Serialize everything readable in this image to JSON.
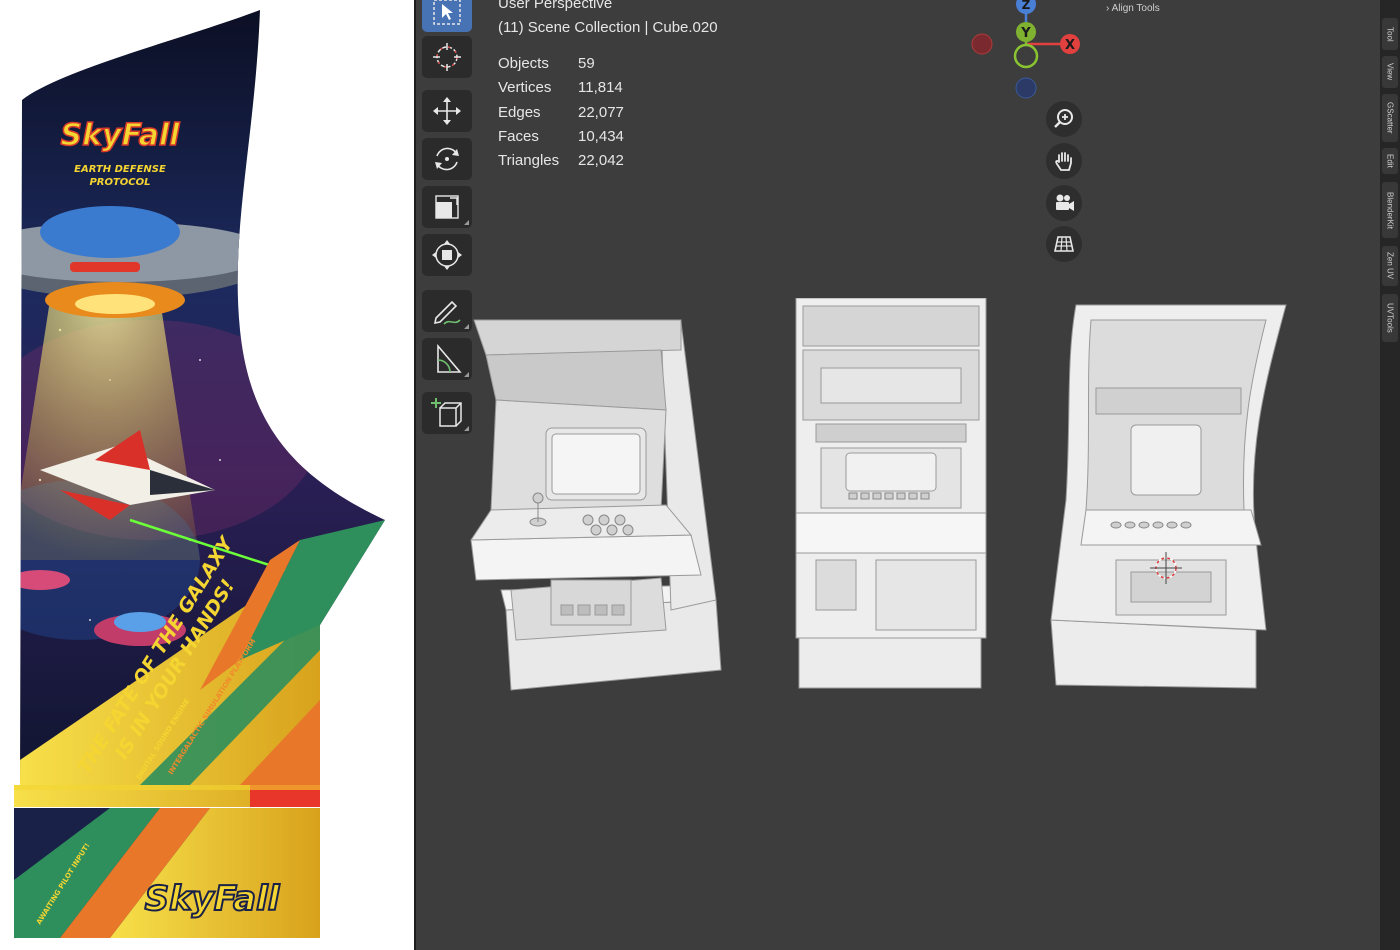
{
  "art": {
    "logo_top": "SkyFall",
    "subtitle_line1": "EARTH DEFENSE",
    "subtitle_line2": "PROTOCOL",
    "slogan_line1": "THE FATE OF THE GALAXY",
    "slogan_line2": "IS IN YOUR HANDS!",
    "stripe_text_1": "DIGITAL SOUND ENGINE",
    "stripe_text_2": "INTERGALACTIC SIMULATION PLATFORM",
    "stripe_text_3": "AWAITING PILOT INPUT!",
    "logo_bottom": "SkyFall",
    "colors": {
      "space": "#141a3a",
      "yellow": "#f4d531",
      "orange": "#e8772a",
      "green": "#2f8f5c",
      "red": "#d93a2b"
    }
  },
  "viewport": {
    "perspective_label": "User Perspective",
    "collection_label": "(11) Scene Collection | Cube.020",
    "stats": [
      {
        "label": "Objects",
        "value": "59"
      },
      {
        "label": "Vertices",
        "value": "11,814"
      },
      {
        "label": "Edges",
        "value": "22,077"
      },
      {
        "label": "Faces",
        "value": "10,434"
      },
      {
        "label": "Triangles",
        "value": "22,042"
      }
    ],
    "gizmo": {
      "x_label": "X",
      "y_label": "Y",
      "z_label": "Z"
    },
    "panel_header": "Align Tools"
  },
  "toolbar": {
    "tools": [
      {
        "name": "select-box-tool",
        "icon": "cursor-arrow-icon",
        "active": true
      },
      {
        "name": "cursor-tool",
        "icon": "crosshair-icon"
      },
      {
        "name": "move-tool",
        "icon": "move-arrows-icon"
      },
      {
        "name": "rotate-tool",
        "icon": "rotate-icon"
      },
      {
        "name": "scale-tool",
        "icon": "scale-icon"
      },
      {
        "name": "transform-tool",
        "icon": "transform-icon"
      },
      {
        "name": "annotate-tool",
        "icon": "pencil-icon"
      },
      {
        "name": "measure-tool",
        "icon": "ruler-icon"
      },
      {
        "name": "add-cube-tool",
        "icon": "add-cube-icon"
      }
    ]
  },
  "nav_buttons": [
    "zoom-icon",
    "hand-pan-icon",
    "camera-icon",
    "grid-ortho-icon"
  ],
  "sidebar_tabs": [
    "Tool",
    "View",
    "GScatter",
    "Edit",
    "BlenderKit",
    "Zen UV",
    "UVTools"
  ]
}
